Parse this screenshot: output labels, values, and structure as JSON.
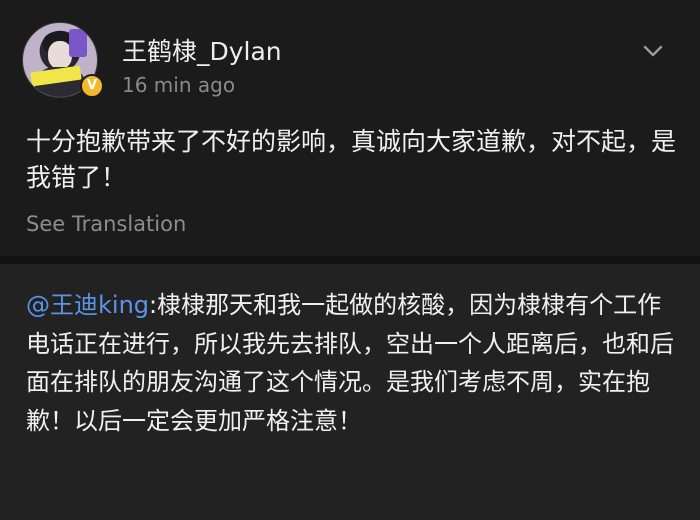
{
  "post": {
    "username": "王鹤棣_Dylan",
    "timestamp": "16 min ago",
    "text": "十分抱歉带来了不好的影响，真诚向大家道歉，对不起，是我错了！",
    "see_translation": "See Translation",
    "verified_mark": "V"
  },
  "reply": {
    "mention": "@王迪king",
    "text": ":棣棣那天和我一起做的核酸，因为棣棣有个工作电话正在进行，所以我先去排队，空出一个人距离后，也和后面在排队的朋友沟通了这个情况。是我们考虑不周，实在抱歉！以后一定会更加严格注意！"
  },
  "icons": {
    "more": "chevron-down-icon",
    "verified": "verified-badge-icon"
  },
  "colors": {
    "background": "#1b1b1b",
    "reply_background": "#222222",
    "mention": "#5b93e6",
    "verified": "#f4b92a"
  }
}
